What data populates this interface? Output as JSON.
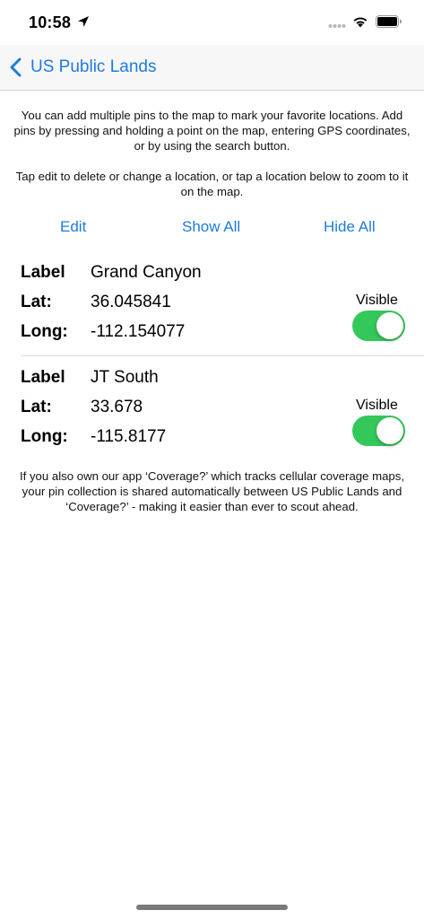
{
  "status_bar": {
    "time": "10:58"
  },
  "nav": {
    "back_label": "US Public Lands"
  },
  "intro": {
    "paragraph1": "You can add multiple pins to the map to mark your favorite locations. Add pins by pressing and holding a point on the map, entering GPS coordinates, or by using the search button.",
    "paragraph2": "Tap edit to delete or change a location, or tap a location below to zoom to it on the map."
  },
  "actions": {
    "edit": "Edit",
    "show_all": "Show All",
    "hide_all": "Hide All"
  },
  "labels": {
    "label": "Label",
    "lat": "Lat:",
    "long": "Long:",
    "visible": "Visible"
  },
  "pins": [
    {
      "label": "Grand Canyon",
      "lat": "36.045841",
      "long": "-112.154077",
      "visible": true
    },
    {
      "label": "JT South",
      "lat": "33.678",
      "long": "-115.8177",
      "visible": true
    }
  ],
  "footer": {
    "text": "If you also own our app ‘Coverage?’ which tracks cellular coverage maps, your pin collection is shared automatically between US Public Lands and ‘Coverage?’ - making it easier than ever to scout ahead."
  },
  "colors": {
    "accent": "#1e7be0",
    "toggle_on": "#34c759",
    "nav_background": "#f7f7f7"
  },
  "icons": [
    "location-arrow-icon",
    "signal-icon",
    "wifi-icon",
    "battery-icon",
    "back-chevron-icon"
  ]
}
